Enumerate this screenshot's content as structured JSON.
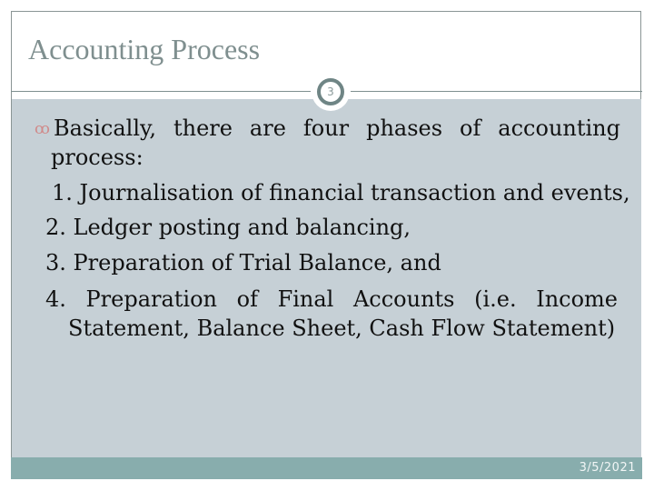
{
  "slide": {
    "title": "Accounting Process",
    "page_number": "3",
    "date": "3/5/2021",
    "bullet_icon": "wingdings-scroll-bullet",
    "intro_line1": "Basically, there are four phases of accounting",
    "intro_line2": "process:",
    "items": [
      "1. Journalisation of financial transaction and events,",
      "2. Ledger posting and balancing,",
      "3. Preparation of Trial Balance, and",
      "4. Preparation of Final Accounts (i.e. Income",
      "Statement, Balance Sheet, Cash Flow Statement)"
    ],
    "colors": {
      "content_bg": "#c6d0d6",
      "footer_bg": "#88adad",
      "title": "#7f8f8f",
      "bullet": "#d08a8a"
    }
  }
}
